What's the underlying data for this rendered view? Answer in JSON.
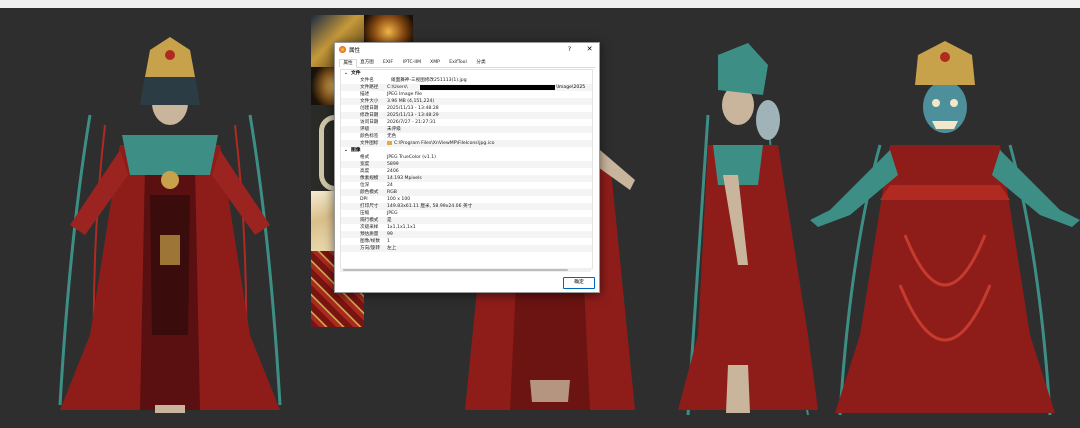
{
  "dialog": {
    "title": "属性",
    "help_label": "?",
    "close_label": "✕",
    "ok_label": "确定",
    "tabs": [
      "属性",
      "直方图",
      "EXIF",
      "IPTC-IIM",
      "XMP",
      "ExifTool",
      "分类"
    ],
    "groups": [
      {
        "caret": "⌄",
        "title": "文件",
        "rows": [
          {
            "k": "文件名",
            "v": "傩面舞神-三视图修改251113(1).jpg"
          },
          {
            "k": "文件路径",
            "v": "C:\\Users\\",
            "tail": "\\Image\\2025"
          },
          {
            "k": "描述",
            "v": "JPEG Image file"
          },
          {
            "k": "文件大小",
            "v": "3.96 MB (4,151,224)"
          },
          {
            "k": "创建日期",
            "v": "2025/11/13 - 13:48:28"
          },
          {
            "k": "修改日期",
            "v": "2025/11/13 - 13:48:29"
          },
          {
            "k": "访问日期",
            "v": "2026/7/27 - 21:27:31"
          },
          {
            "k": "评级",
            "v": "未评级"
          },
          {
            "k": "颜色标签",
            "v": "无色"
          },
          {
            "k": "文件图标",
            "v": "C:\\Program Files\\XnViewMP\\FileIcons\\jpg.ico"
          }
        ]
      },
      {
        "caret": "⌄",
        "title": "图像",
        "rows": [
          {
            "k": "格式",
            "v": "JPEG TrueColor (v1.1)"
          },
          {
            "k": "宽度",
            "v": "5899"
          },
          {
            "k": "高度",
            "v": "2406"
          },
          {
            "k": "像素规模",
            "v": "14.193 Mpixels"
          },
          {
            "k": "位深",
            "v": "24"
          },
          {
            "k": "颜色模式",
            "v": "RGB"
          },
          {
            "k": "DPI",
            "v": "100 x 100"
          },
          {
            "k": "打印尺寸",
            "v": "149.83x61.11 厘米, 58.99x24.06 英寸"
          },
          {
            "k": "压缩",
            "v": "JPEG"
          },
          {
            "k": "隔行模式",
            "v": "是"
          },
          {
            "k": "次级采样",
            "v": "1x1,1x1,1x1"
          },
          {
            "k": "预估质量",
            "v": "99"
          },
          {
            "k": "图像/帧数",
            "v": "1"
          },
          {
            "k": "方向/旋转",
            "v": "左上"
          }
        ]
      }
    ]
  },
  "colors": {
    "background": "#2e2e2e",
    "robe_red": "#8e1d1a",
    "teal_trim": "#3d8f86",
    "gold": "#c8a24a",
    "skin": "#c9b59c",
    "accent_blue": "#0067c0"
  }
}
